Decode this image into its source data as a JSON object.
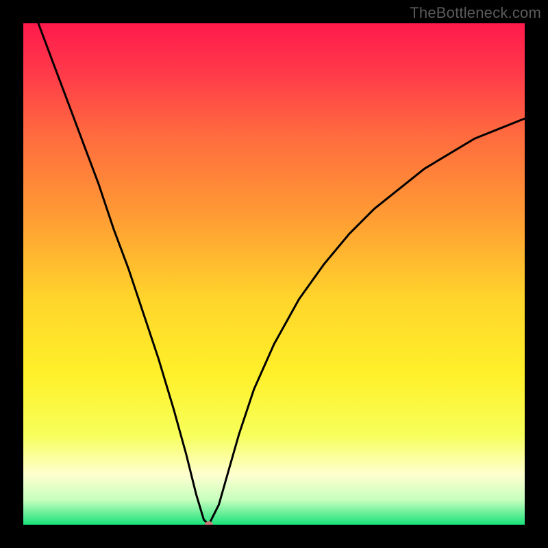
{
  "watermark": "TheBottleneck.com",
  "colors": {
    "bg": "#000000",
    "curve": "#000000",
    "dot": "#c97a7a",
    "gradient_stops": [
      {
        "offset": 0.0,
        "color": "#ff1a4c"
      },
      {
        "offset": 0.1,
        "color": "#ff3a4a"
      },
      {
        "offset": 0.22,
        "color": "#ff6a3f"
      },
      {
        "offset": 0.38,
        "color": "#ff9a34"
      },
      {
        "offset": 0.55,
        "color": "#ffd52b"
      },
      {
        "offset": 0.7,
        "color": "#fff02a"
      },
      {
        "offset": 0.82,
        "color": "#f7ff5a"
      },
      {
        "offset": 0.9,
        "color": "#ffffd0"
      },
      {
        "offset": 0.95,
        "color": "#c8ffbe"
      },
      {
        "offset": 1.0,
        "color": "#19e27a"
      }
    ]
  },
  "chart_data": {
    "type": "line",
    "title": "",
    "xlabel": "",
    "ylabel": "",
    "xlim": [
      0,
      100
    ],
    "ylim": [
      0,
      100
    ],
    "grid": false,
    "series": [
      {
        "name": "curve",
        "x": [
          0,
          3,
          6,
          9,
          12,
          15,
          18,
          21,
          24,
          27,
          30,
          32.5,
          34.5,
          36,
          37,
          39,
          41,
          43,
          46,
          50,
          55,
          60,
          65,
          70,
          75,
          80,
          85,
          90,
          95,
          100
        ],
        "y": [
          108,
          100,
          92,
          84,
          76,
          68,
          59,
          51,
          42,
          33,
          23,
          14,
          6,
          1,
          0,
          4,
          11,
          18,
          27,
          36,
          45,
          52,
          58,
          63,
          67,
          71,
          74,
          77,
          79,
          81
        ]
      }
    ],
    "marker": {
      "x": 37,
      "y": 0,
      "color": "#c97a7a",
      "rx": 6,
      "ry": 5
    }
  }
}
